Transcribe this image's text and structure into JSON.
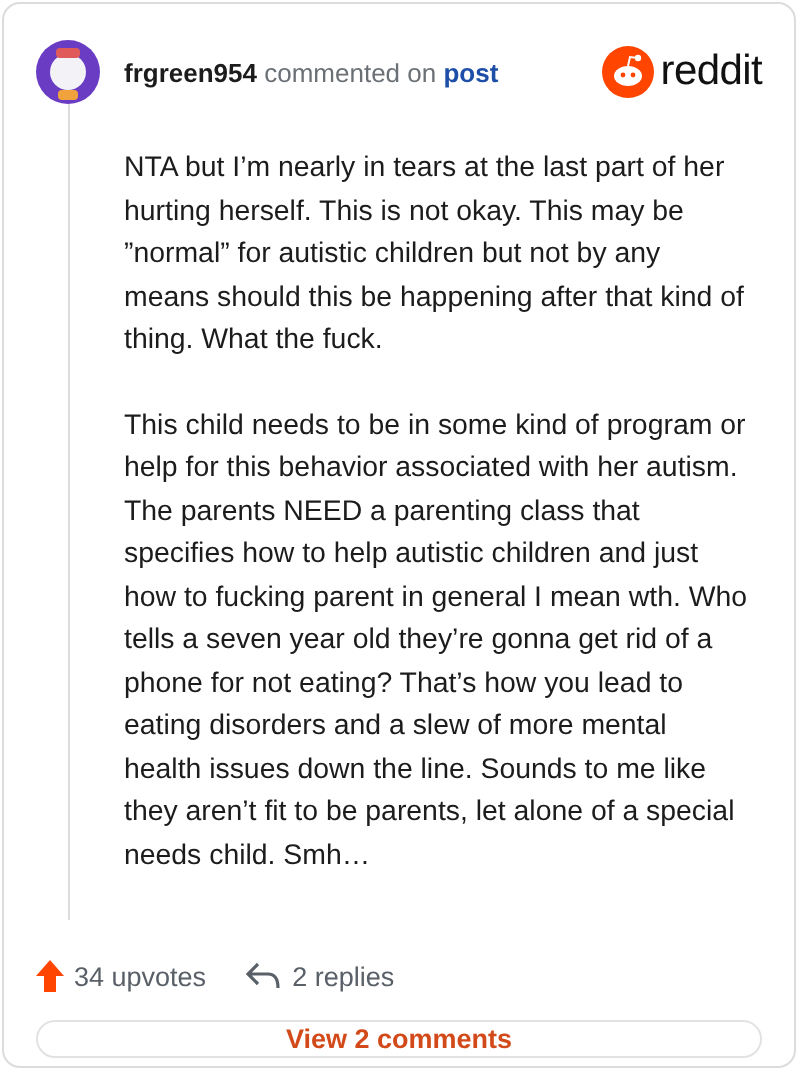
{
  "comment": {
    "author": "frgreen954",
    "action": "commented on",
    "target": "post",
    "brand": "reddit",
    "paragraphs": [
      "NTA but I’m nearly in tears at the last part of her hurting herself. This is not okay. This may be ”normal” for autistic children but not by any means should this be happening after that kind of thing. What the fuck.",
      "This child needs to be in some kind of program or help for this behavior associated with her autism. The parents NEED a parenting class that specifies how to help autistic children and just how to fucking parent in general I mean wth. Who tells a seven year old they’re gonna get rid of a phone for not eating? That’s how you lead to eating disorders and a slew of more mental health issues down the line. Sounds to me like they aren’t fit to be parents, let alone of a special needs child. Smh…"
    ],
    "upvotes": "34 upvotes",
    "replies": "2 replies"
  },
  "button": "View 2 comments"
}
